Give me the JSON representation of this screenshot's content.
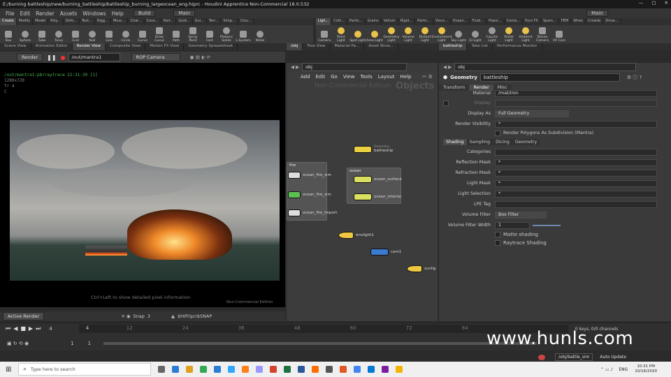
{
  "title_bar": {
    "title": "E:/burning battleship/new/burning_battleship/battleship_burning_largeocean_eng.hiprc - Houdini Apprentice Non-Commercial 18.0.532",
    "minimize": "—",
    "maximize": "□",
    "close": "✕"
  },
  "menu": {
    "items": [
      "File",
      "Edit",
      "Render",
      "Assets",
      "Windows",
      "Help"
    ],
    "desktop_left": "Build",
    "desktop_mid": "Main",
    "desktop_right": "Main"
  },
  "shelf_left": {
    "tabs": [
      "Create",
      "Modify",
      "Model",
      "Poly...",
      "Defo...",
      "Text...",
      "Rigg...",
      "Musc...",
      "Char...",
      "Cons...",
      "Hair...",
      "Guid...",
      "Gui...",
      "Terr...",
      "Simp...",
      "Clou..."
    ],
    "tools": [
      "Box",
      "Sphere",
      "Tube",
      "Torus",
      "Grid",
      "Null",
      "Line",
      "Circle",
      "Curve",
      "Draw Curve",
      "Path",
      "Spray Paint",
      "Font",
      "Platonic Solids",
      "L-System",
      "Metal"
    ]
  },
  "shelf_right": {
    "tabs": [
      "Ligh...",
      "Colli...",
      "Partic...",
      "Grains",
      "Vellum",
      "Rigid...",
      "Partic...",
      "Visco...",
      "Ocean...",
      "Fluid...",
      "Popul...",
      "Conta...",
      "Pyro FX",
      "Spars...",
      "FEM",
      "Wires",
      "Crowds",
      "Drive..."
    ],
    "tools": [
      "Camera",
      "Point Light",
      "Spot Light",
      "Area Light",
      "Geometry Light",
      "Volume Light",
      "Distant Light",
      "Environment Light",
      "Sky Light",
      "GI Light",
      "Caustic Light",
      "Portal Light",
      "Ambient Light",
      "Stereo Camera",
      "VR Cam"
    ]
  },
  "left_pane": {
    "tabs": [
      "Scene View",
      "Animation Editor",
      "Render View",
      "Composite View",
      "Motion FX View",
      "Geometry Spreadsheet"
    ],
    "render_button": "Render",
    "rop_path": "/out/mantra1",
    "camera": "ROP Camera",
    "info_line1": "/out/mantra1:pbrraytrace 22:31:39 [1]",
    "info_line2": "1280x720",
    "info_line3": "fr 4",
    "info_line4": "C",
    "hint": "Ctrl+Left to show detailed pixel information",
    "watermark": "Non-Commercial Edition",
    "bottom_active": "Active Render",
    "snap_label": "Snap",
    "snap_value": "3",
    "snap_path": "$HIP/ipr/$SNAP"
  },
  "net_pane": {
    "tabs": [
      "/obj",
      "Tree View",
      "Material Pa...",
      "Asset Brow..."
    ],
    "path": "obj",
    "menu": [
      "Add",
      "Edit",
      "Go",
      "View",
      "Tools",
      "Layout",
      "Help"
    ],
    "watermark": "Non-Commercial Edition",
    "context_label": "Objects",
    "nodes": [
      {
        "name": "battleship",
        "sub": "Geometry"
      },
      {
        "name": "ocean_surface",
        "sub": ""
      },
      {
        "name": "ocean_interior",
        "sub": ""
      },
      {
        "name": "ocean_fire_sim",
        "sub": ""
      },
      {
        "name": "ocean_fire_sim",
        "sub": ""
      },
      {
        "name": "ocean_fire_import",
        "sub": ""
      },
      {
        "name": "envlight1",
        "sub": ""
      },
      {
        "name": "cam1",
        "sub": ""
      },
      {
        "name": "sunlig",
        "sub": ""
      }
    ],
    "box_left": "fire",
    "box_right": "ocean"
  },
  "param_pane": {
    "tabs": [
      "battleship",
      "Take List",
      "Performance Monitor"
    ],
    "path": "obj",
    "node_type": "Geometry",
    "node_name": "battleship",
    "tabs_main": [
      "Transform",
      "Render",
      "Misc"
    ],
    "tabs_sub": [
      "Shading",
      "Sampling",
      "Dicing",
      "Geometry"
    ],
    "rows": [
      {
        "label": "Material",
        "value": "/mat/iron"
      },
      {
        "label": "Display",
        "value": ""
      },
      {
        "label": "Display As",
        "value": "Full Geometry"
      },
      {
        "label": "Render Visibility",
        "value": "*"
      },
      {
        "label": "",
        "value": "Render Polygons As Subdivision (Mantra)"
      },
      {
        "label": "Categories",
        "value": ""
      },
      {
        "label": "Reflection Mask",
        "value": "*"
      },
      {
        "label": "Refraction Mask",
        "value": "*"
      },
      {
        "label": "Light Mask",
        "value": "*"
      },
      {
        "label": "Light Selection",
        "value": "*"
      },
      {
        "label": "LPE Tag",
        "value": ""
      },
      {
        "label": "Volume Filter",
        "value": "Box Filter"
      },
      {
        "label": "Volume Filter Width",
        "value": "1"
      },
      {
        "label": "",
        "value": "Matte shading"
      },
      {
        "label": "",
        "value": "Raytrace Shading"
      }
    ]
  },
  "timeline": {
    "current_frame": "4",
    "ticks": [
      "4",
      "12",
      "24",
      "36",
      "48",
      "60",
      "72",
      "84"
    ],
    "start": "1",
    "end": "1",
    "keys_info": "0 keys, 0/0 channels",
    "path": "/obj/battle_sim",
    "auto_update": "Auto Update"
  },
  "watermark_site": "www.hunls.com",
  "taskbar": {
    "search": "Type here to search",
    "lang": "ENG",
    "time": "10:31 PM",
    "date": "10/16/2020"
  }
}
